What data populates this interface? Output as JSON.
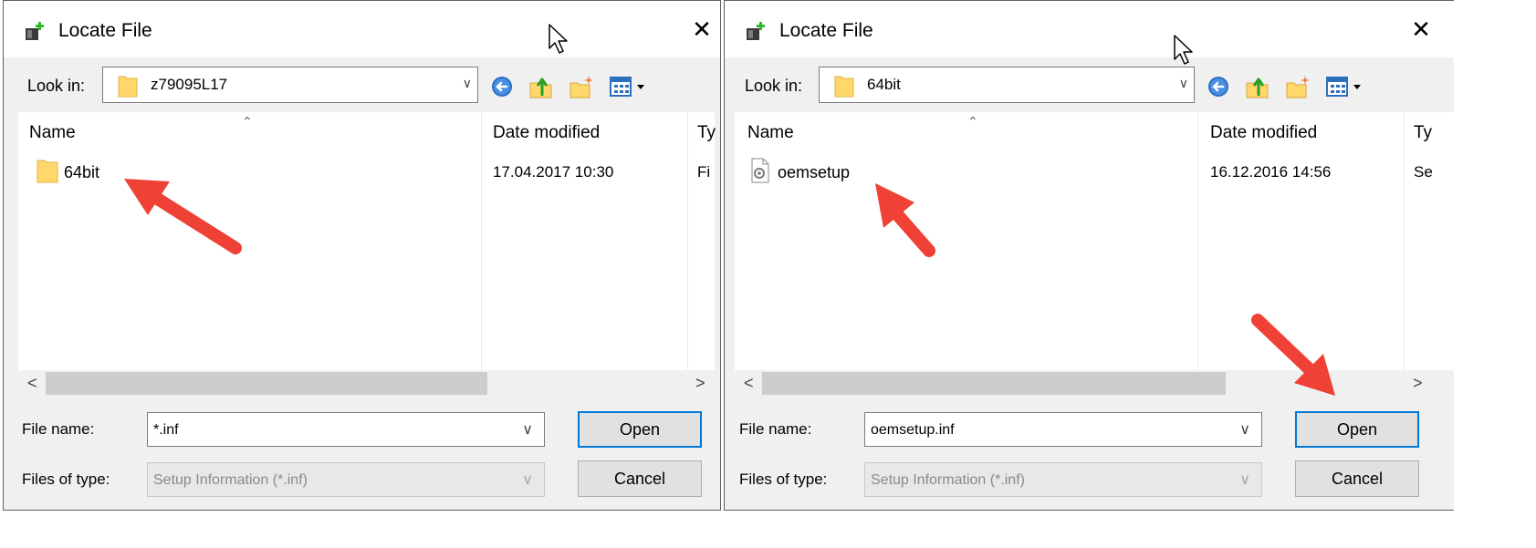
{
  "colors": {
    "arrow": "#ef4135",
    "focus_border": "#0078d7",
    "folder": "#ffd76a"
  },
  "dialogs": [
    {
      "title": "Locate File",
      "close_glyph": "✕",
      "look_in_label": "Look in:",
      "look_in_value": "z79095L17",
      "columns": {
        "name": "Name",
        "date": "Date modified",
        "type": "Ty"
      },
      "rows": [
        {
          "name": "64bit",
          "date": "17.04.2017 10:30",
          "type": "Fi",
          "icon": "folder-icon"
        }
      ],
      "file_name_label": "File name:",
      "file_name_value": "*.inf",
      "files_of_type_label": "Files of type:",
      "files_of_type_value": "Setup Information (*.inf)",
      "open_label": "Open",
      "cancel_label": "Cancel",
      "scroll_left": "<",
      "scroll_right": ">"
    },
    {
      "title": "Locate File",
      "close_glyph": "✕",
      "look_in_label": "Look in:",
      "look_in_value": "64bit",
      "columns": {
        "name": "Name",
        "date": "Date modified",
        "type": "Ty"
      },
      "rows": [
        {
          "name": "oemsetup",
          "date": "16.12.2016 14:56",
          "type": "Se",
          "icon": "setup-file-icon"
        }
      ],
      "file_name_label": "File name:",
      "file_name_value": "oemsetup.inf",
      "files_of_type_label": "Files of type:",
      "files_of_type_value": "Setup Information (*.inf)",
      "open_label": "Open",
      "cancel_label": "Cancel",
      "scroll_left": "<",
      "scroll_right": ">"
    }
  ]
}
